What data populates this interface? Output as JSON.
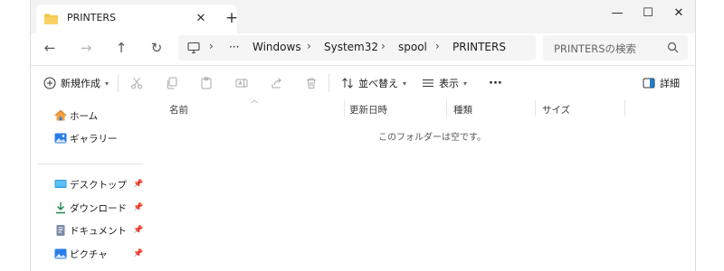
{
  "tab": {
    "title": "PRINTERS",
    "close": "✕",
    "new": "+"
  },
  "window_controls": {
    "minimize": "—",
    "maximize": "☐",
    "close": "✕"
  },
  "nav": {
    "back": "←",
    "forward": "→",
    "up": "↑",
    "refresh": "↻"
  },
  "address": {
    "overflow": "···",
    "separator": "›",
    "crumbs": [
      "Windows",
      "System32",
      "spool",
      "PRINTERS"
    ]
  },
  "search": {
    "placeholder": "PRINTERSの検索"
  },
  "toolbar": {
    "new_label": "新規作成",
    "sort_label": "並べ替え",
    "view_label": "表示",
    "more_label": "···",
    "details_label": "詳細"
  },
  "sidebar": {
    "items": [
      {
        "label": "ホーム",
        "icon": "home-icon"
      },
      {
        "label": "ギャラリー",
        "icon": "gallery-icon"
      },
      {
        "label": "デスクトップ",
        "icon": "desktop-icon",
        "pinned": true
      },
      {
        "label": "ダウンロード",
        "icon": "download-icon",
        "pinned": true
      },
      {
        "label": "ドキュメント",
        "icon": "documents-icon",
        "pinned": true
      },
      {
        "label": "ピクチャ",
        "icon": "pictures-icon",
        "pinned": true
      }
    ],
    "pin_glyph": "📌"
  },
  "columns": [
    "名前",
    "更新日時",
    "種類",
    "サイズ"
  ],
  "empty_message": "このフォルダーは空です。",
  "colors": {
    "titlebar": "#f3f3f3",
    "accent": "#0067c0",
    "folder": "#f4c542"
  }
}
